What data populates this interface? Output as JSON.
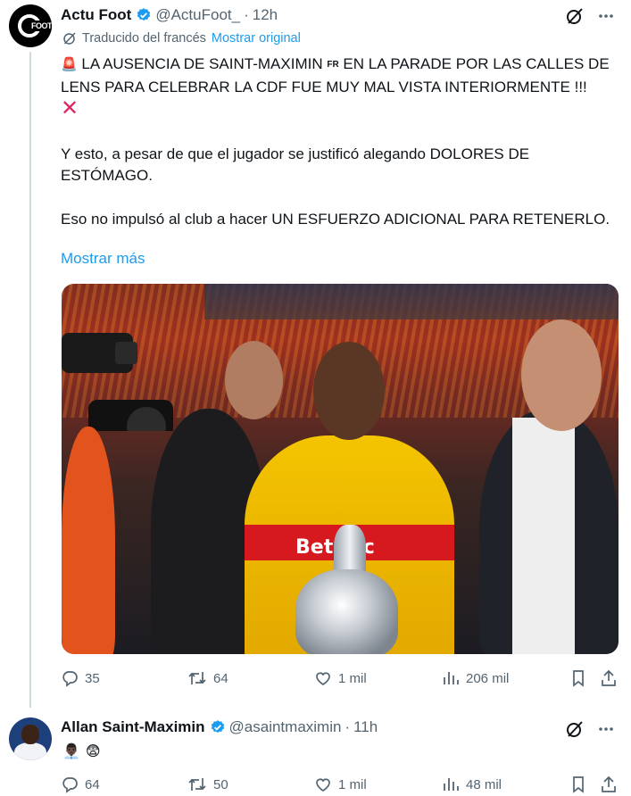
{
  "tweet": {
    "author_name": "Actu Foot",
    "handle": "@ActuFoot_",
    "dot": "·",
    "time": "12h",
    "avatar_text": "FOOT",
    "translated_label": "Traducido del francés",
    "show_original": "Mostrar original",
    "para1_emoji": "🚨",
    "para1_a": "LA AUSENCIA DE SAINT-MAXIMIN",
    "para1_flag": "FR",
    "para1_b": "EN LA PARADE POR LAS CALLES DE LENS PARA CELEBRAR LA CDF FUE MUY MAL VISTA INTERIORMENTE !!!",
    "para1_cross": "✕",
    "para2": "Y esto, a pesar de que el jugador se justificó alegando DOLORES DE ESTÓMAGO.",
    "para3": "Eso no impulsó al club a hacer UN ESFUERZO ADICIONAL PARA RETENERLO.",
    "show_more": "Mostrar más",
    "photo_sponsor": "Bet⊙lic",
    "stats": {
      "replies": "35",
      "retweets": "64",
      "likes": "1 mil",
      "views": "206 mil"
    }
  },
  "reply": {
    "author_name": "Allan Saint-Maximin",
    "handle": "@asaintmaximin",
    "dot": "·",
    "time": "11h",
    "emojis": [
      "👨🏿‍💼",
      "😨"
    ],
    "stats": {
      "replies": "64",
      "retweets": "50",
      "likes": "1 mil",
      "views": "48 mil"
    }
  },
  "icons": [
    "verified-badge-icon",
    "grok-slash-icon",
    "more-icon",
    "reply-icon",
    "retweet-icon",
    "like-icon",
    "views-icon",
    "bookmark-icon",
    "share-icon"
  ],
  "colors": {
    "link": "#1d9bf0",
    "verified": "#1d9bf0",
    "muted": "#536471",
    "text": "#0f1419",
    "thread_line": "#cfd9de"
  }
}
